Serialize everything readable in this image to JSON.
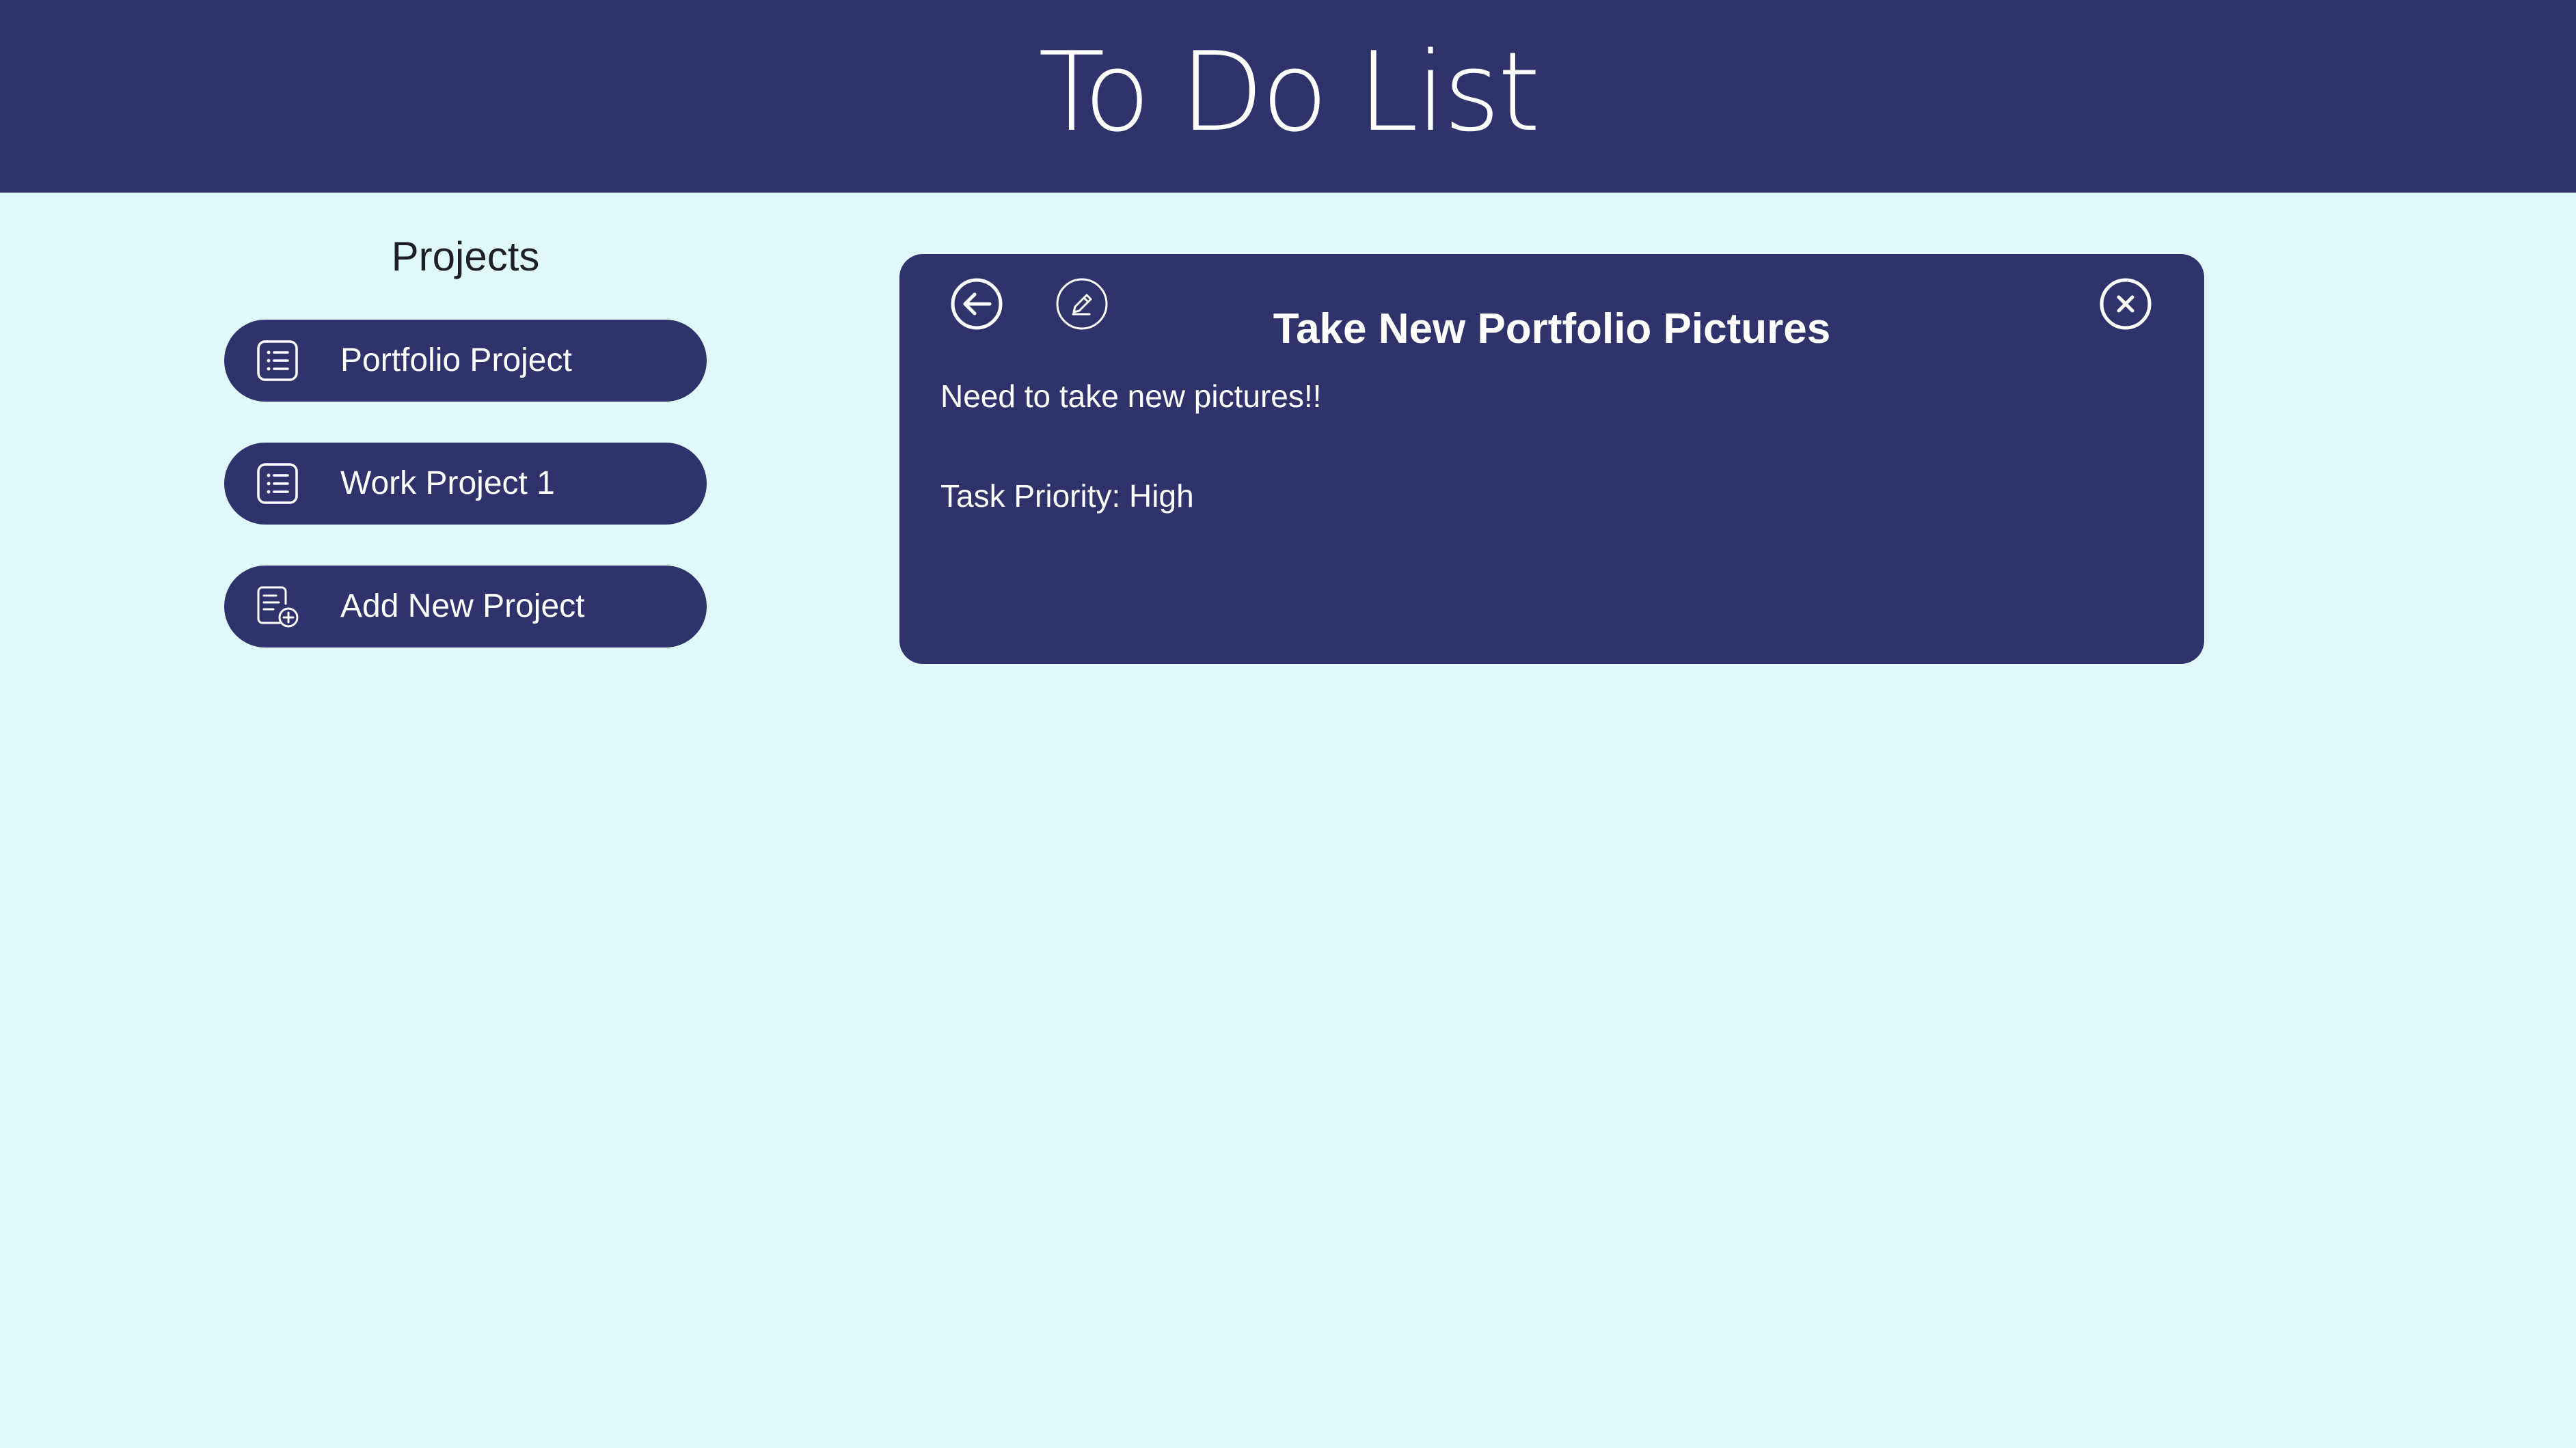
{
  "header": {
    "title": "To Do List"
  },
  "sidebar": {
    "heading": "Projects",
    "projects": [
      {
        "label": "Portfolio Project",
        "icon": "list-icon"
      },
      {
        "label": "Work Project 1",
        "icon": "list-icon"
      }
    ],
    "add_project": {
      "label": "Add New Project",
      "icon": "add-document-icon"
    }
  },
  "task": {
    "title": "Take New Portfolio Pictures",
    "description": "Need to take new pictures!!",
    "priority": "Task Priority: High",
    "actions": {
      "back_icon": "back-arrow-icon",
      "edit_icon": "pencil-icon",
      "close_icon": "close-icon"
    }
  },
  "colors": {
    "primary": "#30336b",
    "background": "#dff8f9",
    "text_on_primary": "#ffffff",
    "heading_text": "#1f1f2a"
  }
}
